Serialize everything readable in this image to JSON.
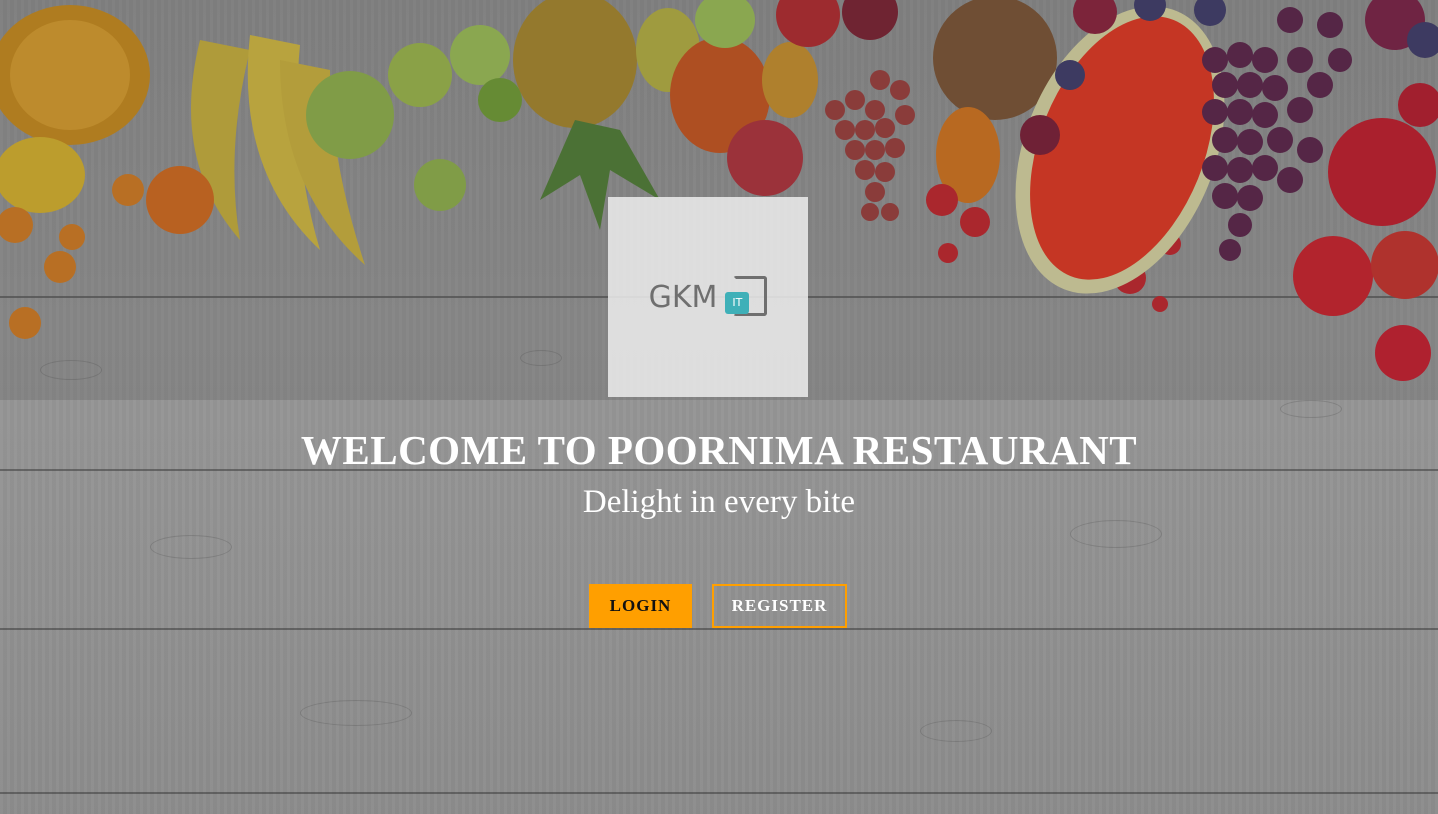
{
  "logo": {
    "text": "GKM",
    "mark_text": "IT",
    "accent_color": "#3fb0b8"
  },
  "hero": {
    "title": "WELCOME TO POORNIMA RESTAURANT",
    "tagline": "Delight in every bite"
  },
  "actions": {
    "login_label": "LOGIN",
    "register_label": "REGISTER",
    "primary_color": "#ff9f00"
  },
  "background": {
    "description_icons": [
      "fruit-banner-image",
      "wood-plank-background"
    ]
  }
}
